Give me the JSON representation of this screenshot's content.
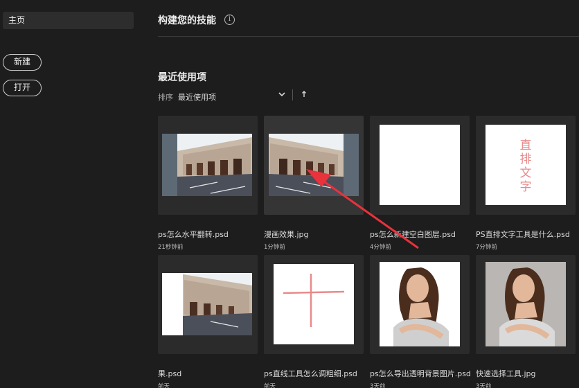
{
  "sidebar": {
    "home_label": "主页",
    "new_label": "新建",
    "open_label": "打开"
  },
  "skills": {
    "title": "构建您的技能",
    "info_icon_glyph": "i"
  },
  "recent": {
    "title": "最近使用项",
    "sort_label": "排序",
    "sort_value": "最近使用项",
    "files": [
      {
        "name": "ps怎么水平翻转.psd",
        "time": "21秒钟前",
        "thumb": "street"
      },
      {
        "name": "漫画效果.jpg",
        "time": "1分钟前",
        "thumb": "street-mirrored"
      },
      {
        "name": "ps怎么新建空白图层.psd",
        "time": "4分钟前",
        "thumb": "blank"
      },
      {
        "name": "PS直排文字工具是什么.psd",
        "time": "7分钟前",
        "thumb": "vertical-text",
        "thumb_text": "直排文字"
      },
      {
        "name": "果.psd",
        "time": "前天",
        "thumb": "street-partial"
      },
      {
        "name": "ps直线工具怎么调粗细.psd",
        "time": "前天",
        "thumb": "cross"
      },
      {
        "name": "ps怎么导出透明背景图片.psd",
        "time": "3天前",
        "thumb": "portrait-white"
      },
      {
        "name": "快速选择工具.jpg",
        "time": "3天前",
        "thumb": "portrait-gray"
      }
    ]
  },
  "colors": {
    "background": "#1d1d1d",
    "card": "#2b2b2b",
    "accent_red": "#e8323c",
    "text_pink": "#e88a8a"
  }
}
